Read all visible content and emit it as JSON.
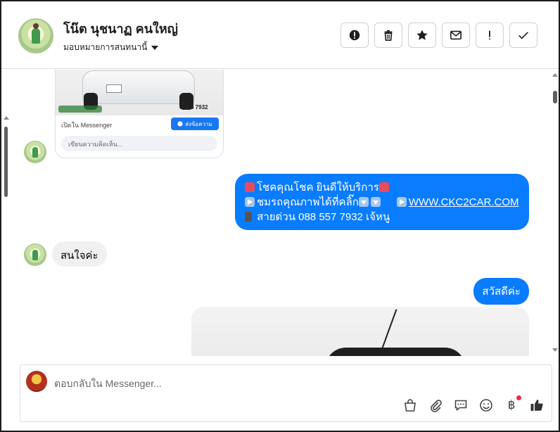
{
  "header": {
    "contact_name": "โน๊ต นุชนาฏ คนใหญ่",
    "assign_label": "มอบหมายการสนทนานี้",
    "actions": [
      {
        "icon": "alert-circle-icon",
        "name": "mark-spam-button"
      },
      {
        "icon": "trash-icon",
        "name": "delete-button"
      },
      {
        "icon": "star-icon",
        "name": "star-button"
      },
      {
        "icon": "envelope-icon",
        "name": "mark-unread-button"
      },
      {
        "icon": "exclamation-icon",
        "name": "follow-up-button"
      },
      {
        "icon": "check-icon",
        "name": "mark-done-button"
      }
    ]
  },
  "shared_card": {
    "phone_partial": "088-5 7932",
    "open_in_label": "เปิดใน Messenger",
    "send_button_label": "ส่งข้อความ",
    "comment_placeholder": "เขียนความคิดเห็น..."
  },
  "messages": {
    "promo_line1": "โชคคุณโชค ยินดีให้บริการ",
    "promo_line2": "ชมรถคุณภาพได้ที่คลิ๊ก",
    "promo_link": "WWW.CKC2CAR.COM",
    "promo_line3": "สายด่วน 088 557 7932 เจ้หนู",
    "reply_in": "สนใจค่ะ",
    "hello_out": "สวัสดีค่ะ"
  },
  "composer": {
    "placeholder": "ตอบกลับใน Messenger...",
    "tools": [
      "bag-icon",
      "paperclip-icon",
      "chat-bubble-icon",
      "smiley-icon",
      "baht-icon",
      "thumbs-up-icon"
    ],
    "baht_symbol": "฿"
  }
}
